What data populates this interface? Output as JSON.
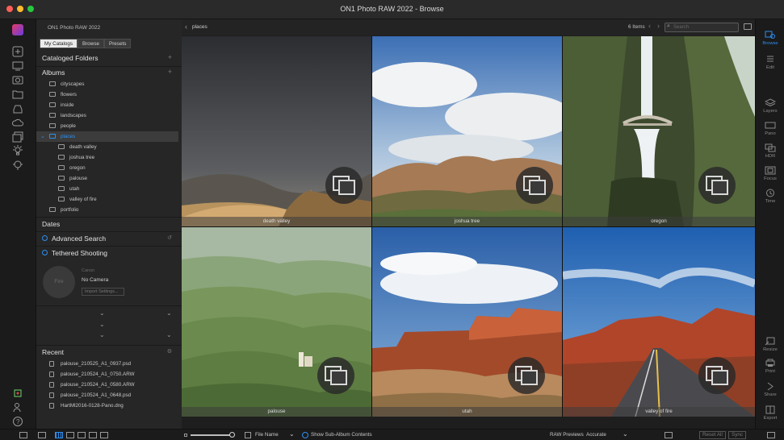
{
  "window": {
    "title": "ON1 Photo RAW 2022 - Browse",
    "traffic_colors": [
      "#fe5f57",
      "#febc2e",
      "#28c840"
    ]
  },
  "left_panel": {
    "app_name": "ON1 Photo RAW 2022",
    "tabs": [
      "My Catalogs",
      "Browse",
      "Presets"
    ],
    "cataloged_folders": "Cataloged Folders",
    "albums_title": "Albums",
    "albums": [
      "cityscapes",
      "flowers",
      "inside",
      "landscapes",
      "people"
    ],
    "places_label": "places",
    "places_children": [
      "death valley",
      "joshua tree",
      "oregon",
      "palouse",
      "utah",
      "valley of fire"
    ],
    "portfolio_label": "portfolio",
    "dates": "Dates",
    "advanced_search": "Advanced Search",
    "tethered_shooting": "Tethered Shooting",
    "tether": {
      "camera_label": "Canon",
      "fire_label": "Fire",
      "no_camera": "No Camera",
      "import_settings": "Import Settings..."
    },
    "recent_title": "Recent",
    "recent": [
      "palouse_210525_A1_0937.psd",
      "palouse_210524_A1_0750.ARW",
      "palouse_210524_A1_0580.ARW",
      "palouse_210524_A1_0648.psd",
      "HartMl2016-0128-Pano.dng"
    ]
  },
  "topbar": {
    "breadcrumb": "places",
    "count": "6 Items",
    "search_placeholder": "Search"
  },
  "grid": {
    "tiles": [
      {
        "caption": "death valley"
      },
      {
        "caption": "joshua tree"
      },
      {
        "caption": "oregon"
      },
      {
        "caption": "palouse"
      },
      {
        "caption": "utah"
      },
      {
        "caption": "valley of fire"
      }
    ]
  },
  "right_rail": {
    "items": [
      {
        "label": "Browse",
        "icon": "browse-icon"
      },
      {
        "label": "Edit",
        "icon": "edit-icon"
      },
      {
        "label": "Layers",
        "icon": "layers-icon"
      },
      {
        "label": "Pano",
        "icon": "pano-icon"
      },
      {
        "label": "HDR",
        "icon": "hdr-icon"
      },
      {
        "label": "Focus",
        "icon": "focus-icon"
      },
      {
        "label": "Time",
        "icon": "time-icon"
      },
      {
        "label": "Resize",
        "icon": "resize-icon"
      },
      {
        "label": "Print",
        "icon": "print-icon"
      },
      {
        "label": "Share",
        "icon": "share-icon"
      },
      {
        "label": "Export",
        "icon": "export-icon"
      }
    ],
    "accent": "#2f8ef0"
  },
  "bottombar": {
    "sort_label": "File Name",
    "show_sub_album": "Show Sub-Album Contents",
    "raw_previews_label": "RAW Previews",
    "raw_previews_value": "Accurate",
    "reset_all": "Reset All",
    "sync": "Sync"
  }
}
